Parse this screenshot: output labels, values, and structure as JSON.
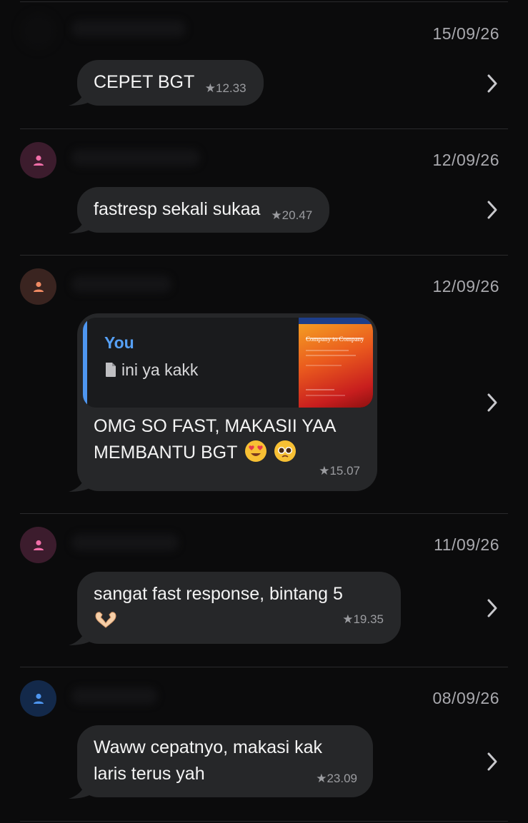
{
  "colors": {
    "background": "#0b0b0c",
    "bubble": "#262729",
    "quote_accent": "#4e96f0",
    "timestamp": "#9b9ca0"
  },
  "reviews": [
    {
      "date": "15/09/26",
      "text": "CEPET BGT",
      "rating_time": "12.33",
      "avatar_color": "hidden",
      "icon": "chevron-right-icon"
    },
    {
      "date": "12/09/26",
      "text": "fastresp sekali sukaa",
      "rating_time": "20.47",
      "avatar_color": "#f06ea8",
      "icon": "chevron-right-icon"
    },
    {
      "date": "12/09/26",
      "quote_author": "You",
      "quote_text": "ini ya kakk",
      "text": "OMG SO FAST, MAKASII YAA MEMBANTU BGT",
      "emoji": [
        "smiling-face-with-heart-eyes",
        "pleading-face"
      ],
      "rating_time": "15.07",
      "avatar_color": "#f08a63",
      "icon": "chevron-right-icon"
    },
    {
      "date": "11/09/26",
      "text": "sangat fast response, bintang 5",
      "emoji": [
        "heart-hands"
      ],
      "rating_time": "19.35",
      "avatar_color": "#f06ea8",
      "icon": "chevron-right-icon"
    },
    {
      "date": "08/09/26",
      "text": "Waww cepatnyo, makasi kak laris terus yah",
      "rating_time": "23.09",
      "avatar_color": "#4e96f0",
      "icon": "chevron-right-icon"
    }
  ],
  "thumbnail": {
    "title": "Company to Company"
  }
}
